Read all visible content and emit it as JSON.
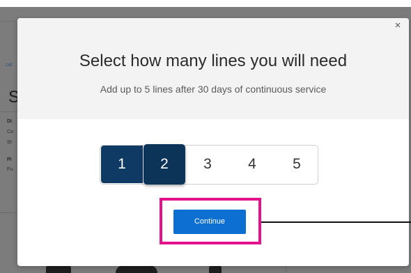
{
  "background": {
    "crumb": "cat",
    "big_letter": "S",
    "lines": [
      "DI",
      "Co",
      "St",
      "PI",
      "Fu"
    ]
  },
  "modal": {
    "title": "Select how many lines you will need",
    "subtitle": "Add up to 5 lines after 30 days of continuous service",
    "close_icon": "×",
    "line_options": [
      "1",
      "2",
      "3",
      "4",
      "5"
    ],
    "selected_lines": 2,
    "continue_label": "Continue",
    "colors": {
      "selected": "#0f3a64",
      "continue": "#0d6fd1",
      "highlight": "#e4138d"
    }
  }
}
